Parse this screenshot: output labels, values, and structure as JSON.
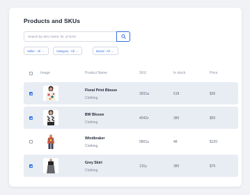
{
  "title": "Products and SKUs",
  "search": {
    "placeholder": "Search by SKU name, ID, or EAN"
  },
  "filters": [
    {
      "label": "Seller :",
      "value": "All"
    },
    {
      "label": "Category :",
      "value": "All"
    },
    {
      "label": "Brand :",
      "value": "All"
    }
  ],
  "table": {
    "headers": [
      "Image",
      "Product Name",
      "SKU",
      "In stock",
      "Price"
    ],
    "rows": [
      {
        "selected": true,
        "name": "Floral Print Blouse",
        "category": "Clothing",
        "sku": "3931a",
        "stock": "518",
        "price": "$35"
      },
      {
        "selected": true,
        "name": "BW Blouse",
        "category": "Clothing",
        "sku": "4042z",
        "stock": "380",
        "price": "$50"
      },
      {
        "selected": false,
        "name": "Windbraker",
        "category": "Clothing",
        "sku": "5801u",
        "stock": "48",
        "price": "$120"
      },
      {
        "selected": true,
        "name": "Grey Skirt",
        "category": "Clothing",
        "sku": "131y",
        "stock": "380",
        "price": "$75"
      }
    ]
  },
  "colors": {
    "accent": "#2f6fe0",
    "row_selected": "#e8edf4"
  }
}
